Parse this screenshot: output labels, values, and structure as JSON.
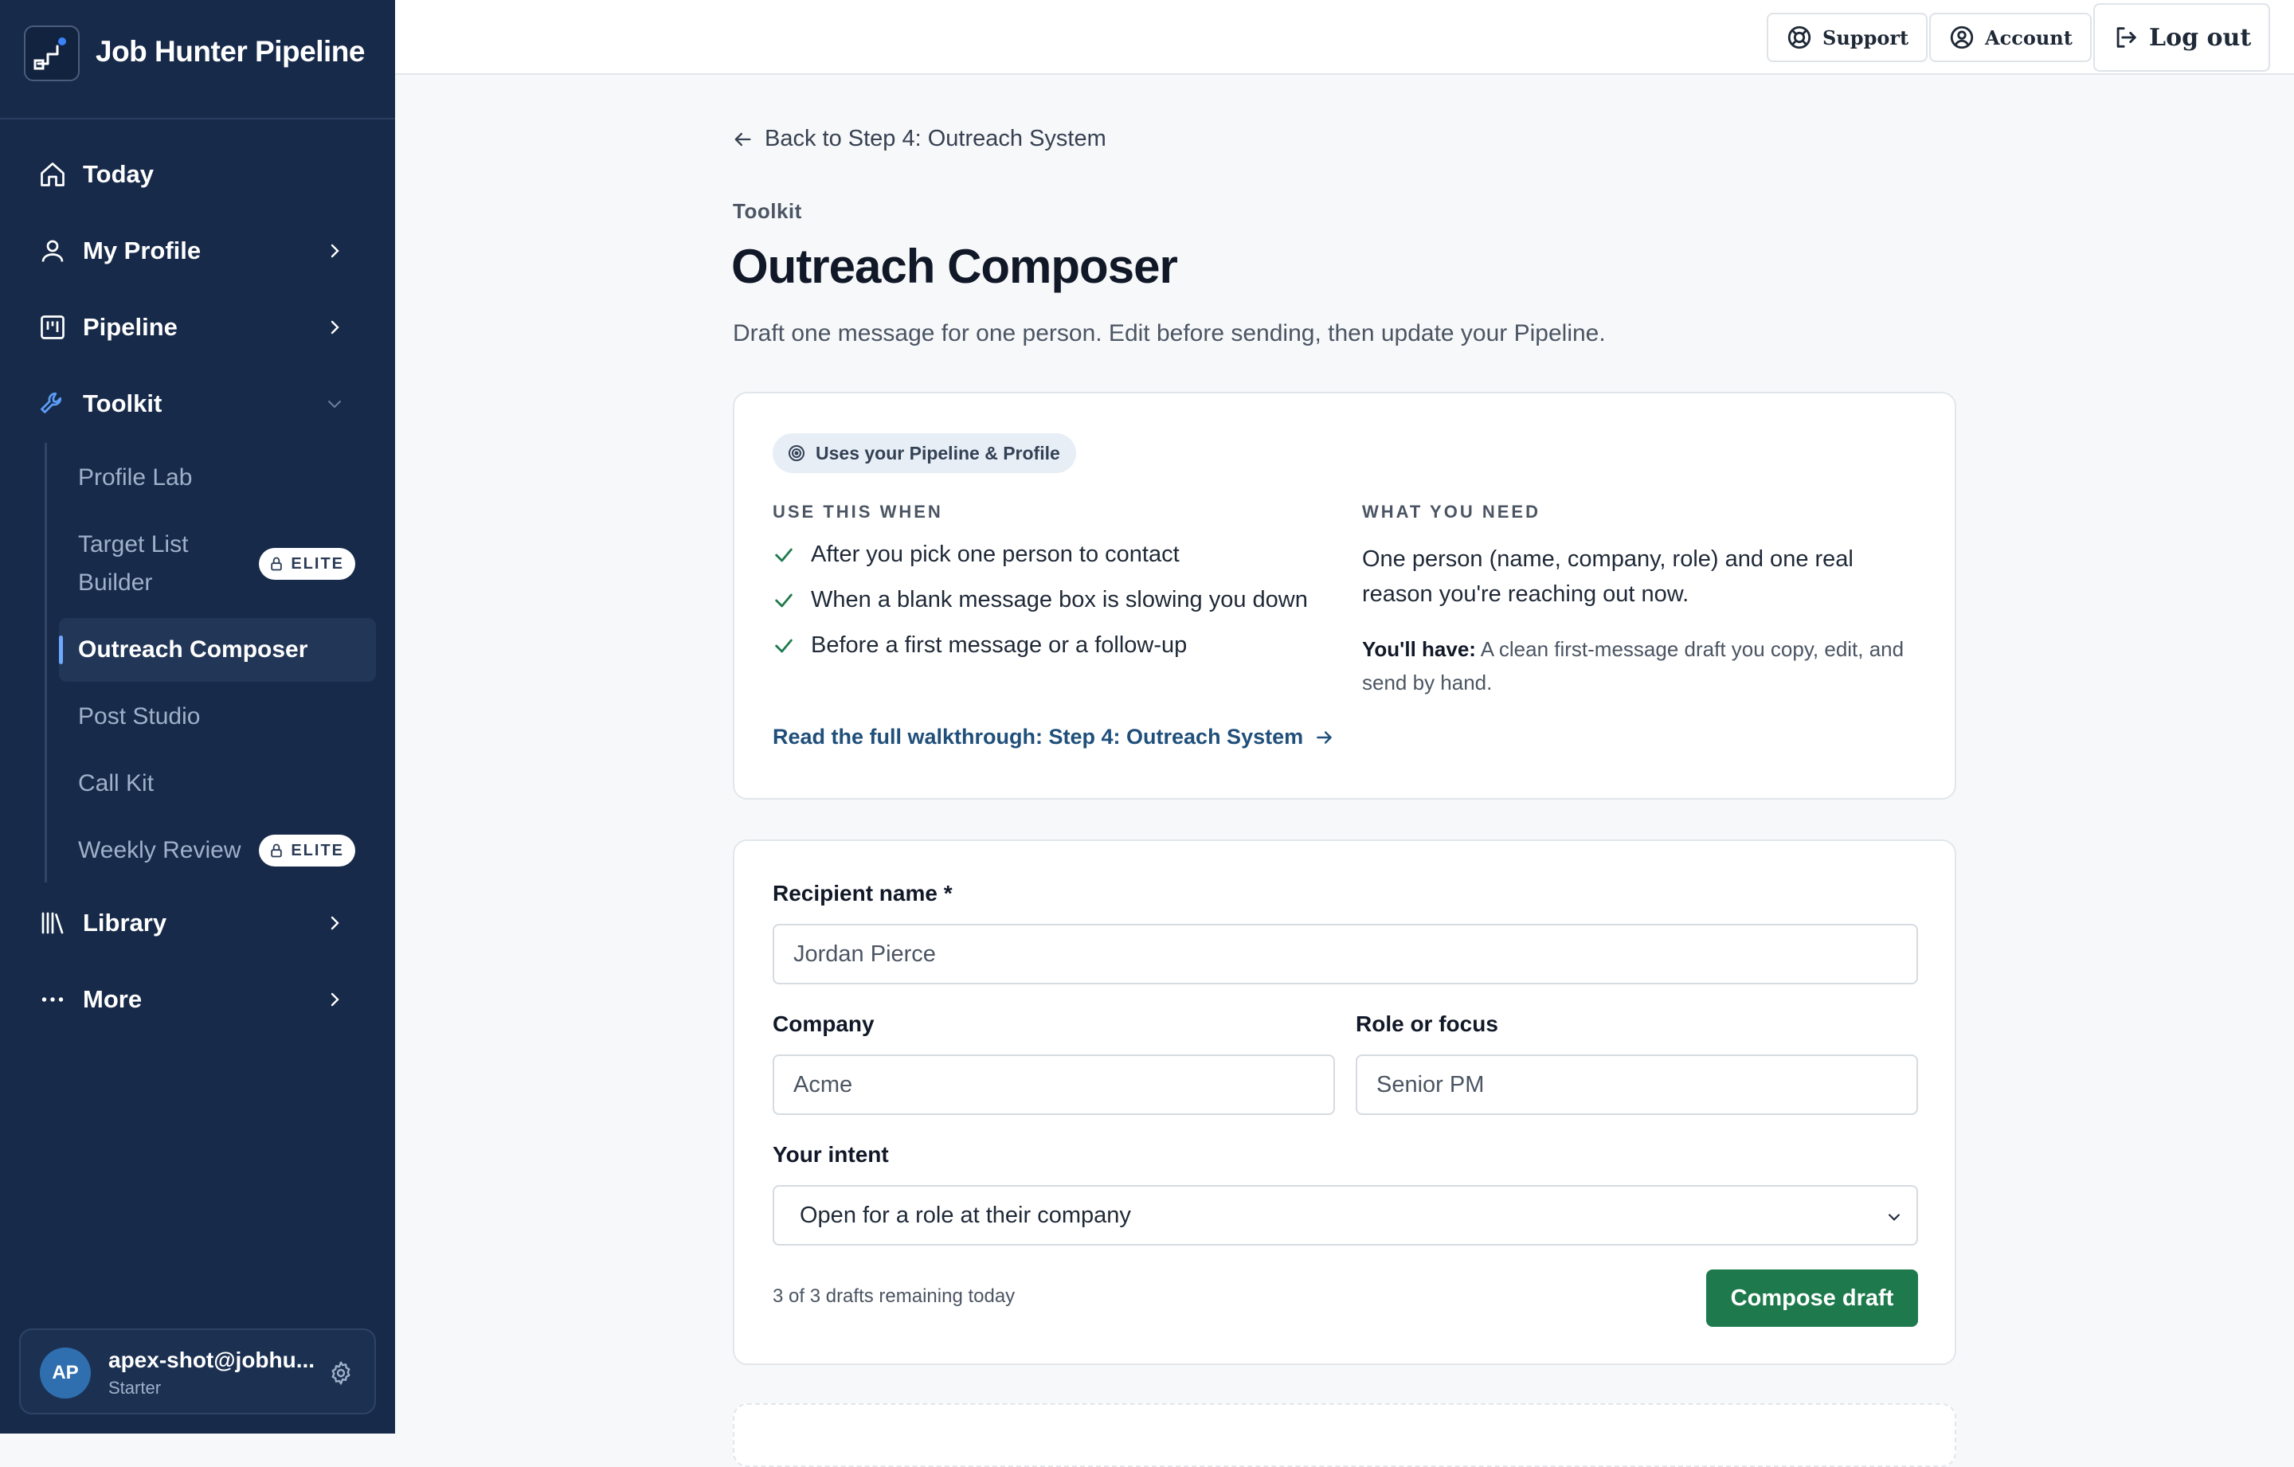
{
  "brand": {
    "name": "Job Hunter Pipeline",
    "logo_icon": "pipeline-logo-icon"
  },
  "sidebar": {
    "nav": [
      {
        "label": "Today",
        "icon": "home-icon"
      },
      {
        "label": "My Profile",
        "icon": "user-icon"
      },
      {
        "label": "Pipeline",
        "icon": "kanban-icon"
      },
      {
        "label": "Toolkit",
        "icon": "wrench-icon",
        "expanded": true
      },
      {
        "label": "Library",
        "icon": "library-icon"
      },
      {
        "label": "More",
        "icon": "more-dots-icon"
      }
    ],
    "toolkit_items": [
      {
        "label": "Profile Lab"
      },
      {
        "label": "Target List Builder",
        "badge": "ELITE"
      },
      {
        "label": "Outreach Composer",
        "active": true
      },
      {
        "label": "Post Studio"
      },
      {
        "label": "Call Kit"
      },
      {
        "label": "Weekly Review",
        "badge": "ELITE"
      }
    ],
    "user": {
      "initials": "AP",
      "email": "apex-shot@jobhu...",
      "plan": "Starter"
    }
  },
  "topbar": {
    "support": "Support",
    "account": "Account",
    "logout": "Log out"
  },
  "page": {
    "back_link": "Back to Step 4: Outreach System",
    "eyebrow": "Toolkit",
    "title": "Outreach Composer",
    "subtitle": "Draft one message for one person. Edit before sending, then update your Pipeline."
  },
  "info_card": {
    "pill": "Uses your Pipeline & Profile",
    "use_when_heading": "USE THIS WHEN",
    "use_when": [
      "After you pick one person to contact",
      "When a blank message box is slowing you down",
      "Before a first message or a follow-up"
    ],
    "need_heading": "WHAT YOU NEED",
    "need_text": "One person (name, company, role) and one real reason you're reaching out now.",
    "have_label": "You'll have:",
    "have_text": "A clean first-message draft you copy, edit, and send by hand.",
    "walkthrough_link": "Read the full walkthrough: Step 4: Outreach System"
  },
  "form": {
    "recipient_label": "Recipient name *",
    "recipient_value": "Jordan Pierce",
    "company_label": "Company",
    "company_value": "Acme",
    "role_label": "Role or focus",
    "role_value": "Senior PM",
    "intent_label": "Your intent",
    "intent_selected": "Open for a role at their company",
    "remaining": "3 of 3 drafts remaining today",
    "submit": "Compose draft"
  },
  "colors": {
    "sidebar_bg": "#172a4a",
    "accent_blue": "#3b82f6",
    "primary_button": "#1e7a4c",
    "link": "#1f4f7a"
  }
}
